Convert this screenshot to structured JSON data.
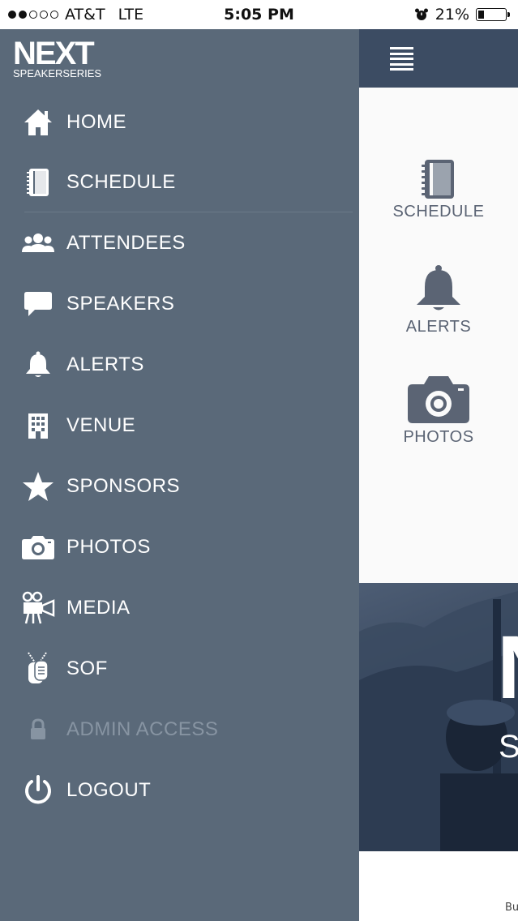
{
  "status_bar": {
    "carrier": "AT&T",
    "network": "LTE",
    "time": "5:05 PM",
    "battery": "21%",
    "signal_bars": 2
  },
  "drawer": {
    "logo_main": "NEXT",
    "logo_sub": "SPEAKERSERIES",
    "items": [
      {
        "label": "HOME",
        "icon": "home-icon"
      },
      {
        "label": "SCHEDULE",
        "icon": "notebook-icon"
      },
      {
        "label": "ATTENDEES",
        "icon": "people-icon"
      },
      {
        "label": "SPEAKERS",
        "icon": "speech-bubble-icon"
      },
      {
        "label": "ALERTS",
        "icon": "bell-icon"
      },
      {
        "label": "VENUE",
        "icon": "building-icon"
      },
      {
        "label": "SPONSORS",
        "icon": "star-icon"
      },
      {
        "label": "PHOTOS",
        "icon": "camera-icon"
      },
      {
        "label": "MEDIA",
        "icon": "film-camera-icon"
      },
      {
        "label": "SOF",
        "icon": "dog-tags-icon"
      },
      {
        "label": "ADMIN ACCESS",
        "icon": "lock-icon",
        "disabled": true
      },
      {
        "label": "LOGOUT",
        "icon": "power-icon"
      }
    ]
  },
  "main": {
    "tiles": [
      {
        "label": "SCHEDULE",
        "icon": "notebook-icon"
      },
      {
        "label": "ALERTS",
        "icon": "bell-icon"
      },
      {
        "label": "PHOTOS",
        "icon": "camera-icon"
      }
    ],
    "banner_text_big": "N",
    "banner_text_small": "SP",
    "footer_text": "Bu"
  },
  "colors": {
    "drawer_bg": "#5a6979",
    "topbar_bg": "#3c4c63",
    "tile_icon": "#5b6474",
    "disabled_text": "#8794a2"
  }
}
